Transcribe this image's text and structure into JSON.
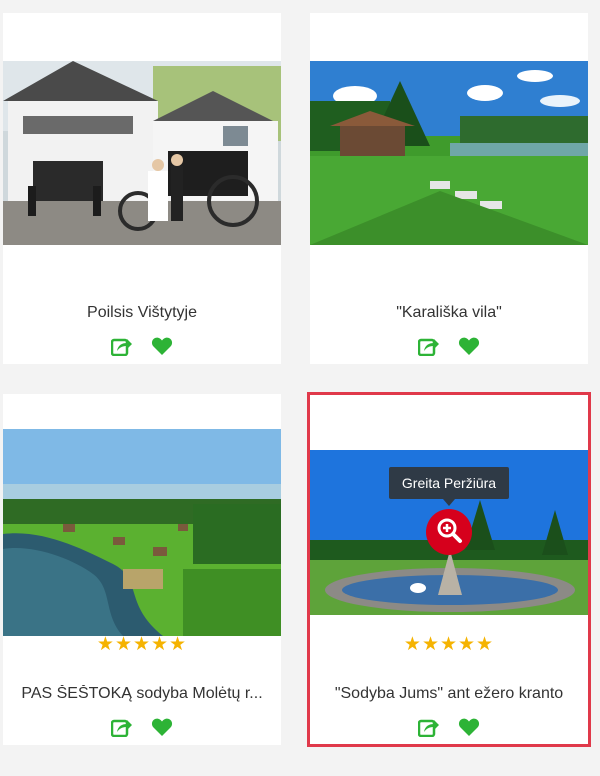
{
  "cards": [
    {
      "title": "Poilsis Vištytyje"
    },
    {
      "title": "\"Karališka vila\""
    },
    {
      "title": "PAS ŠEŠTOKĄ sodyba Molėtų r...",
      "stars": "★★★★★"
    },
    {
      "title": "\"Sodyba Jums\" ant ežero kranto",
      "stars": "★★★★★",
      "tooltip": "Greita Peržiūra"
    }
  ],
  "colors": {
    "accent_green": "#2db336",
    "star": "#f5b301",
    "highlight": "#e0394a",
    "zoom": "#d6001c"
  },
  "icons": [
    "share-icon",
    "heart-icon",
    "zoom-in-icon"
  ]
}
